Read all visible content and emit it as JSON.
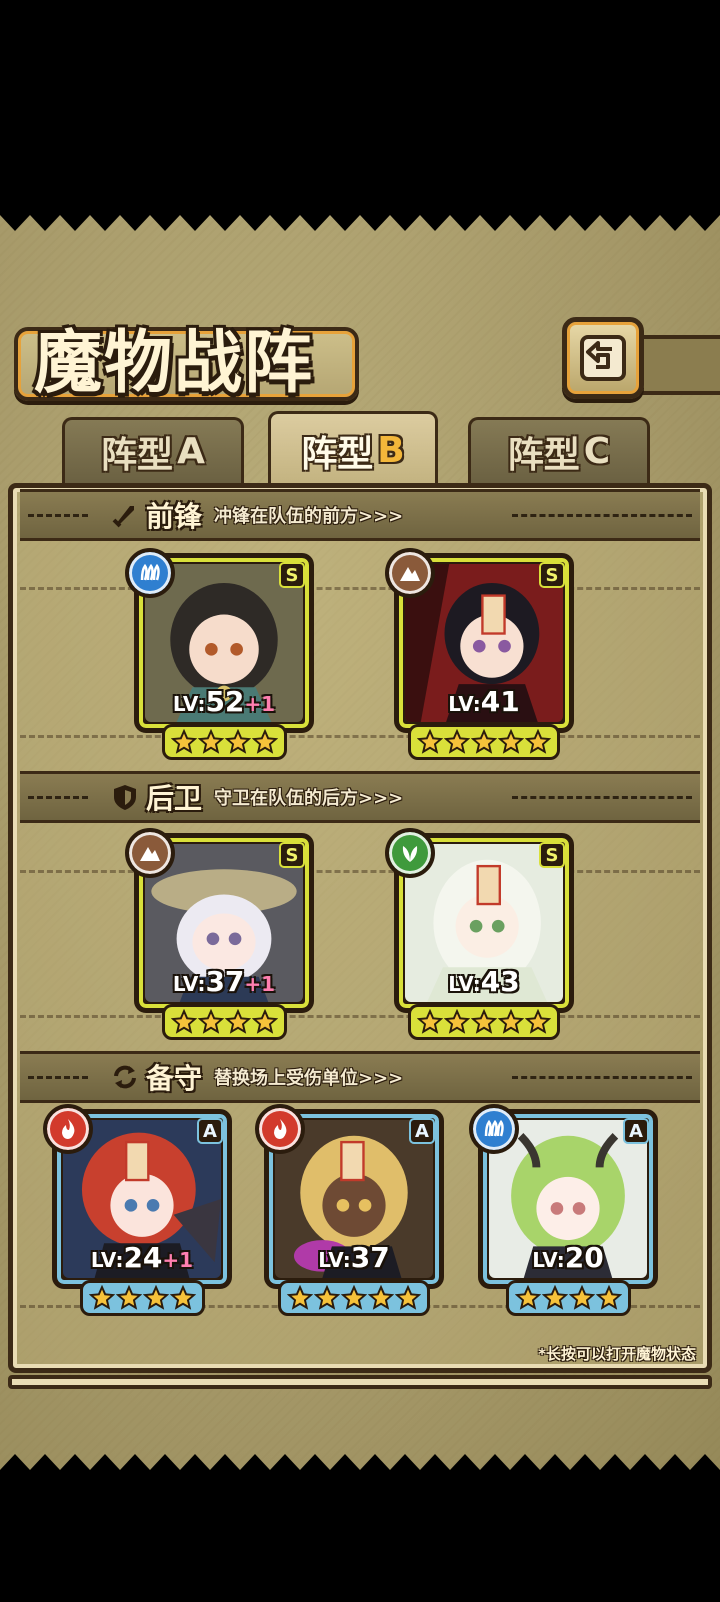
{
  "header": {
    "title": "魔物战阵",
    "back_icon": "back-arrow-icon"
  },
  "tabs": [
    {
      "label": "阵型",
      "letter": "A",
      "active": false
    },
    {
      "label": "阵型",
      "letter": "B",
      "active": true
    },
    {
      "label": "阵型",
      "letter": "C",
      "active": false
    }
  ],
  "sections": {
    "front": {
      "name": "前锋",
      "desc": "冲锋在队伍的前方>>>",
      "icon": "sword-icon"
    },
    "rear": {
      "name": "后卫",
      "desc": "守卫在队伍的后方>>>",
      "icon": "shield-icon"
    },
    "reserve": {
      "name": "备守",
      "desc": "替换场上受伤单位>>>",
      "icon": "swap-icon"
    }
  },
  "units": {
    "front": [
      {
        "element": "water",
        "rank": "S",
        "lv_prefix": "LV:",
        "lv": "52",
        "plus": "+1",
        "stars": 4
      },
      {
        "element": "earth",
        "rank": "S",
        "lv_prefix": "LV:",
        "lv": "41",
        "plus": "",
        "stars": 5
      }
    ],
    "rear": [
      {
        "element": "earth",
        "rank": "S",
        "lv_prefix": "LV:",
        "lv": "37",
        "plus": "+1",
        "stars": 4
      },
      {
        "element": "wind",
        "rank": "S",
        "lv_prefix": "LV:",
        "lv": "43",
        "plus": "",
        "stars": 5
      }
    ],
    "reserve": [
      {
        "element": "fire",
        "rank": "A",
        "lv_prefix": "LV:",
        "lv": "24",
        "plus": "+1",
        "stars": 4
      },
      {
        "element": "fire",
        "rank": "A",
        "lv_prefix": "LV:",
        "lv": "37",
        "plus": "",
        "stars": 5
      },
      {
        "element": "water",
        "rank": "A",
        "lv_prefix": "LV:",
        "lv": "20",
        "plus": "",
        "stars": 4
      }
    ]
  },
  "footer": {
    "note": "*长按可以打开魔物状态"
  },
  "colors": {
    "water": "#2f7fd0",
    "earth": "#8a5a3a",
    "wind": "#3f9a3c",
    "fire": "#d23a2c",
    "rank_s": "#d9e03a",
    "rank_a": "#7cc2de",
    "star": "#f6c23a"
  }
}
